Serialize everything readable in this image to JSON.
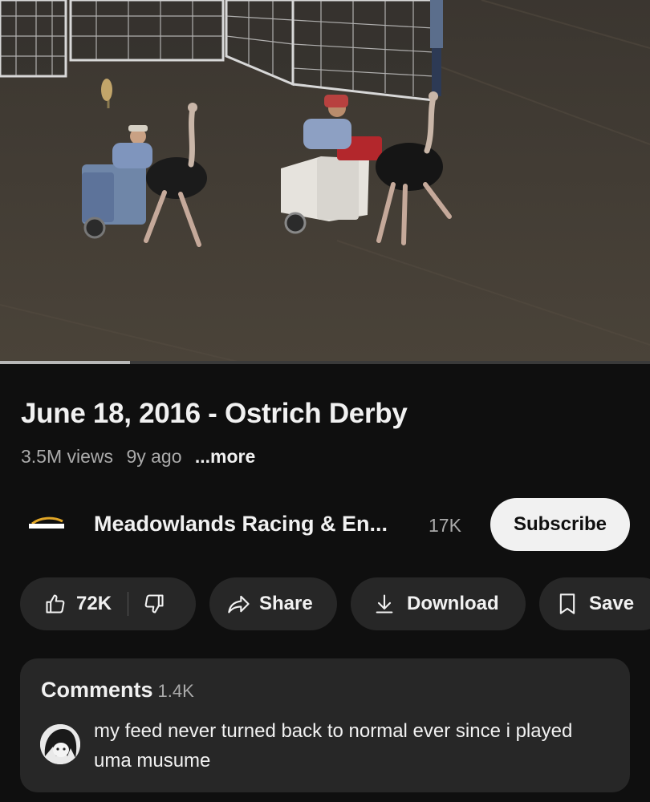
{
  "video": {
    "title": "June 18, 2016 - Ostrich Derby",
    "views": "3.5M views",
    "age": "9y ago",
    "more_label": "...more",
    "progress_fraction": 0.2
  },
  "channel": {
    "name": "Meadowlands Racing & En...",
    "subscribers": "17K",
    "subscribe_label": "Subscribe",
    "logo_text": "MEADOWLANDS"
  },
  "actions": {
    "like_count": "72K",
    "like_icon": "thumbs-up-icon",
    "dislike_icon": "thumbs-down-icon",
    "share_label": "Share",
    "share_icon": "share-arrow-icon",
    "download_label": "Download",
    "download_icon": "download-icon",
    "save_label": "Save",
    "save_icon": "bookmark-icon"
  },
  "comments": {
    "heading": "Comments",
    "count": "1.4K",
    "top_comment": "my feed never turned back to normal ever since i played uma musume"
  },
  "colors": {
    "background": "#0f0f0f",
    "pill": "#272727",
    "text": "#f1f1f1",
    "secondary_text": "#aaaaaa",
    "subscribe_bg": "#f1f1f1"
  }
}
